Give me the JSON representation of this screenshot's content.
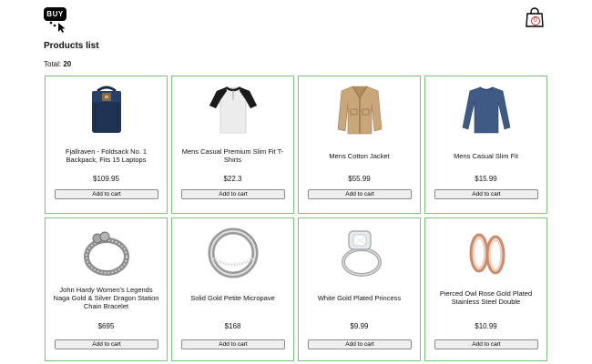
{
  "header": {
    "logo_text": "BUY",
    "cart_count": "0",
    "logo_icon": "buy-logo-with-cursor",
    "cart_icon": "shopping-bag-icon"
  },
  "page": {
    "title": "Products list",
    "total_label": "Total:",
    "total_value": "20"
  },
  "colors": {
    "card_border": "#7dc27d",
    "cart_badge": "#c62828"
  },
  "products": [
    {
      "name": "Fjallraven - Foldsack No. 1 Backpack, Fits 15 Laptops",
      "price": "$109.95",
      "button": "Add to cart",
      "image": "backpack"
    },
    {
      "name": "Mens Casual Premium Slim Fit T-Shirts",
      "price": "$22.3",
      "button": "Add to cart",
      "image": "raglan-tshirt"
    },
    {
      "name": "Mens Cotton Jacket",
      "price": "$55.99",
      "button": "Add to cart",
      "image": "jacket"
    },
    {
      "name": "Mens Casual Slim Fit",
      "price": "$15.99",
      "button": "Add to cart",
      "image": "long-sleeve-shirt"
    },
    {
      "name": "John Hardy Women's Legends Naga Gold & Silver Dragon Station Chain Bracelet",
      "price": "$695",
      "button": "Add to cart",
      "image": "chain-bracelet"
    },
    {
      "name": "Solid Gold Petite Micropave",
      "price": "$168",
      "button": "Add to cart",
      "image": "silver-ring"
    },
    {
      "name": "White Gold Plated Princess",
      "price": "$9.99",
      "button": "Add to cart",
      "image": "diamond-ring"
    },
    {
      "name": "Pierced Owl Rose Gold Plated Stainless Steel Double",
      "price": "$10.99",
      "button": "Add to cart",
      "image": "rose-gold-plugs"
    }
  ]
}
